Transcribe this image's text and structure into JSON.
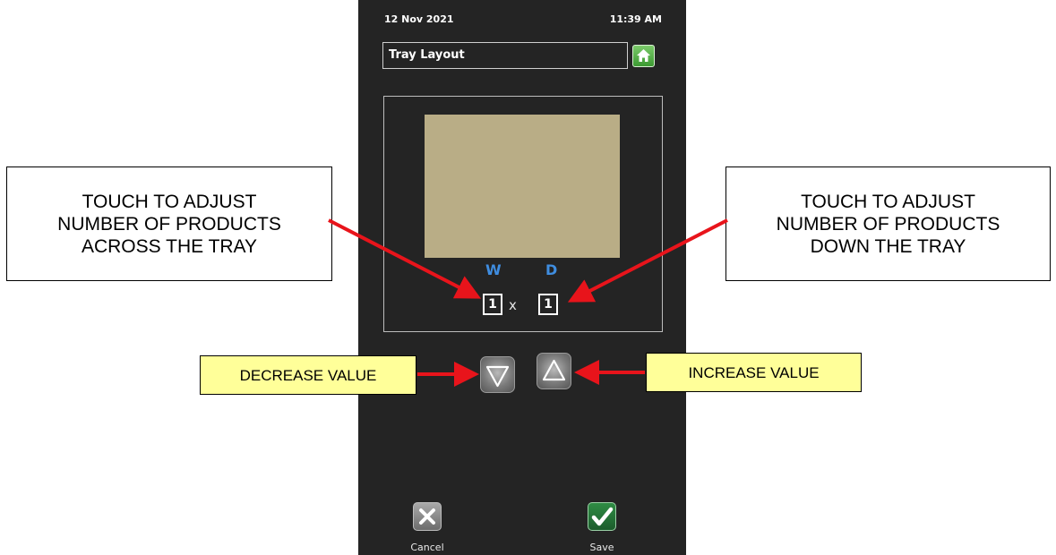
{
  "status_bar": {
    "date": "12 Nov 2021",
    "time": "11:39 AM"
  },
  "header": {
    "title": "Tray Layout",
    "home_icon": "home-icon"
  },
  "layout": {
    "width_label": "W",
    "depth_label": "D",
    "width_value": "1",
    "depth_value": "1",
    "separator": "x"
  },
  "controls": {
    "decrease_icon": "triangle-down-icon",
    "increase_icon": "triangle-up-icon"
  },
  "footer": {
    "cancel_label": "Cancel",
    "save_label": "Save"
  },
  "callouts": {
    "across": "TOUCH TO ADJUST\nNUMBER OF PRODUCTS\nACROSS THE TRAY",
    "down": "TOUCH TO ADJUST\nNUMBER OF PRODUCTS\nDOWN THE TRAY",
    "decrease": "DECREASE VALUE",
    "increase": "INCREASE VALUE"
  },
  "colors": {
    "screen_bg": "#242424",
    "tray": "#b9ad86",
    "axis_label": "#3f8de0",
    "callout_highlight": "#ffff99",
    "arrow": "#e8141b"
  }
}
